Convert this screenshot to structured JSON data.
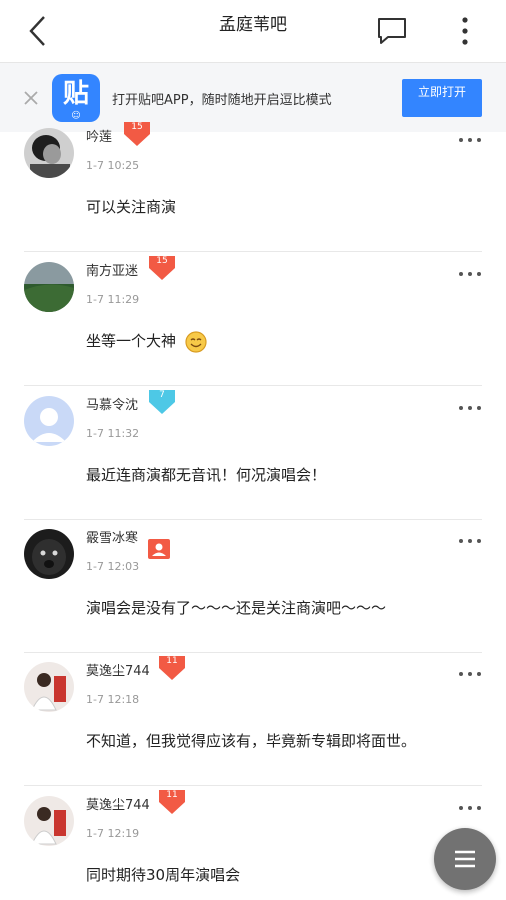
{
  "header": {
    "title": "孟庭苇吧"
  },
  "promo": {
    "text": "打开贴吧APP，随时随地开启逗比模式",
    "open_label": "立即打开",
    "logo_glyph": "贴",
    "logo_sub": "☺"
  },
  "posts": [
    {
      "name": "吟莲",
      "level": "15",
      "time": "1-7 10:25",
      "content": "可以关注商演"
    },
    {
      "name": "南方亚迷",
      "level": "15",
      "time": "1-7 11:29",
      "content": "坐等一个大神"
    },
    {
      "name": "马慕令沈",
      "level": "7",
      "time": "1-7 11:32",
      "content": "最近连商演都无音讯！何况演唱会！"
    },
    {
      "name": "霰雪冰寒",
      "level": "",
      "time": "1-7 12:03",
      "content": "演唱会是没有了～～～还是关注商演吧～～～"
    },
    {
      "name": "莫逸尘744",
      "level": "11",
      "time": "1-7 12:18",
      "content": "不知道，但我觉得应该有，毕竟新专辑即将面世。"
    },
    {
      "name": "莫逸尘744",
      "level": "11",
      "time": "1-7 12:19",
      "content": "同时期待30周年演唱会"
    }
  ],
  "colors": {
    "accent": "#3385ff",
    "badge_red": "#f25a44",
    "badge_cyan": "#4dc8e6"
  }
}
